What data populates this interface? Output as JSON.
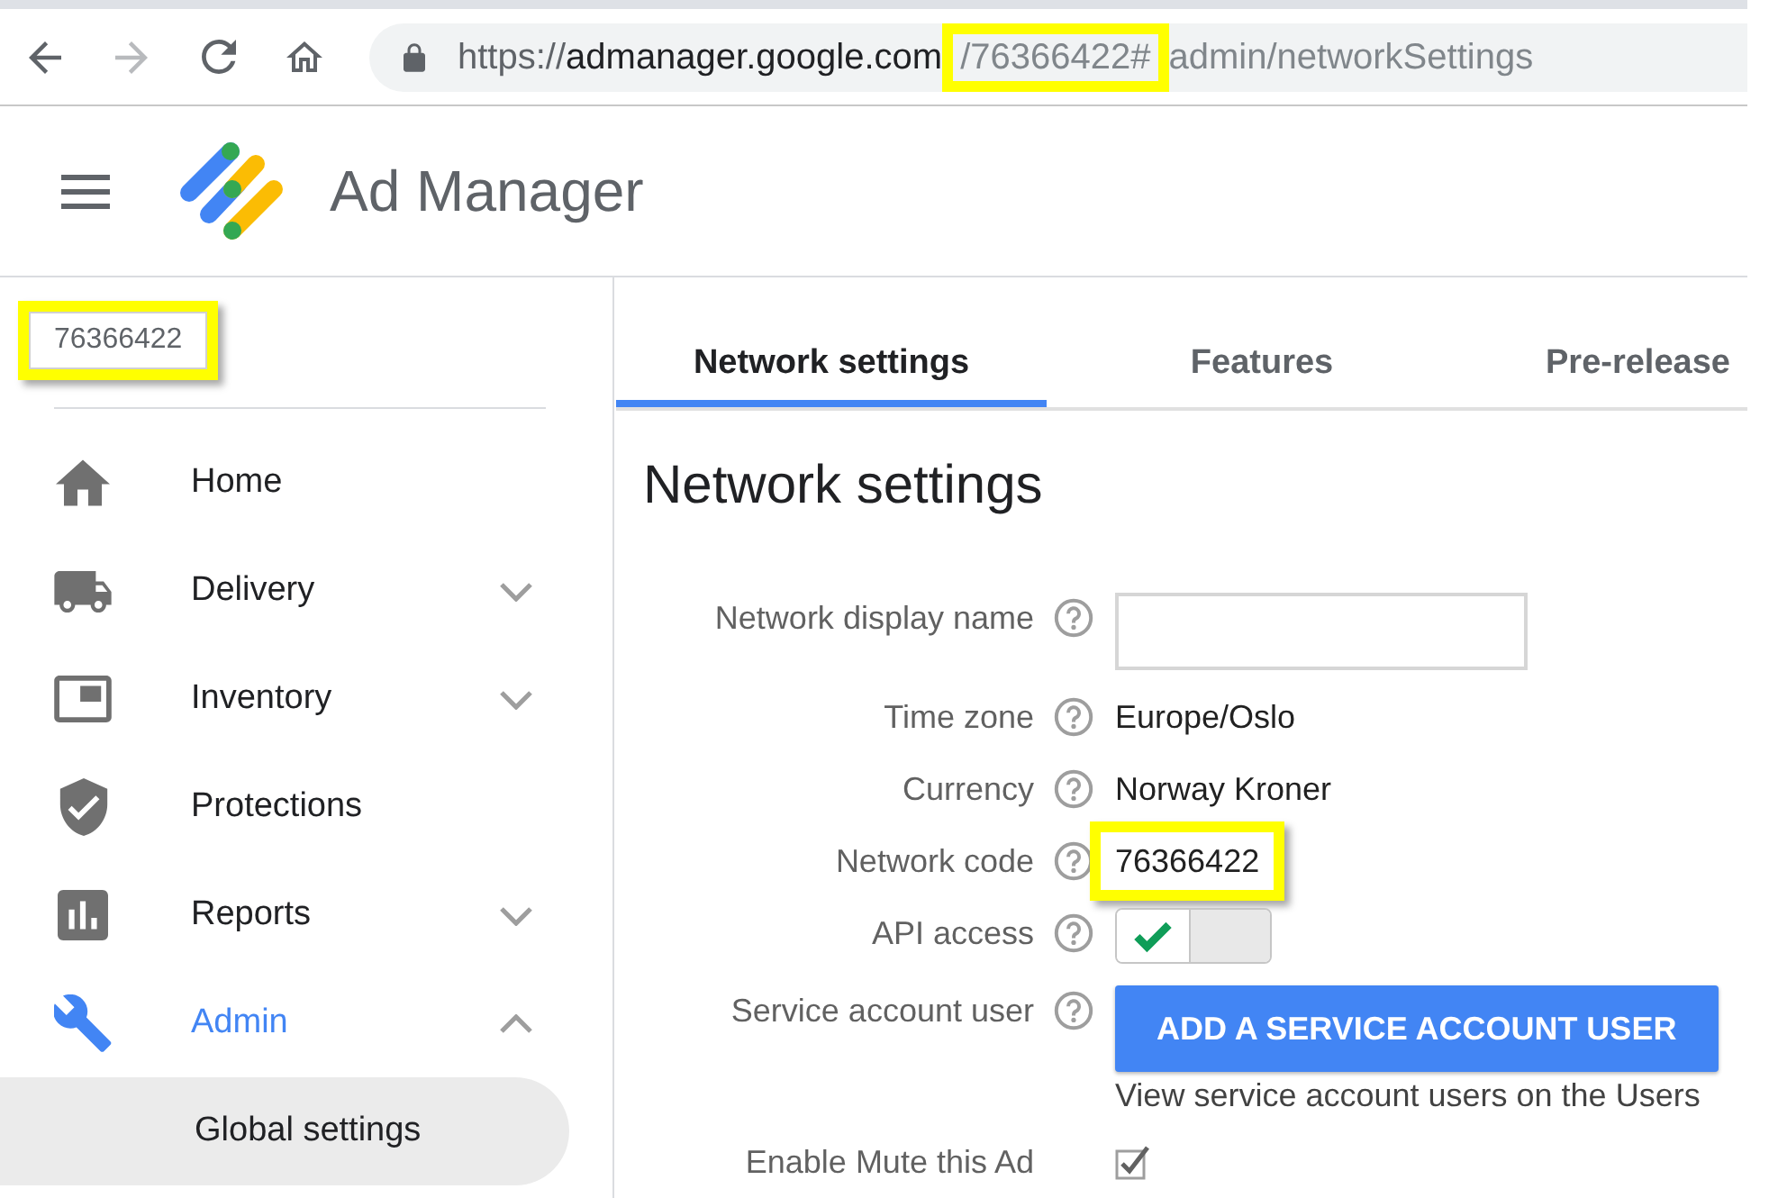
{
  "browser": {
    "nav_buttons": [
      {
        "kind": "back",
        "disabled": false
      },
      {
        "kind": "forward",
        "disabled": true
      },
      {
        "kind": "reload",
        "disabled": false
      },
      {
        "kind": "home",
        "disabled": false
      }
    ],
    "url": [
      {
        "kind": "scheme",
        "text": "https://",
        "highlighted": false
      },
      {
        "kind": "host",
        "text": "admanager.google.com",
        "highlighted": false
      },
      {
        "kind": "path",
        "text": "/76366422#",
        "highlighted": true
      },
      {
        "kind": "path",
        "text": "admin/networkSettings",
        "highlighted": false
      }
    ]
  },
  "header": {
    "title": "Ad Manager"
  },
  "sidebar": {
    "network_code": {
      "text": "76366422",
      "highlighted": true
    },
    "items": [
      {
        "label": "Home",
        "selected": false,
        "expandable": false
      },
      {
        "label": "Delivery",
        "selected": false,
        "expandable": true,
        "expanded": false
      },
      {
        "label": "Inventory",
        "selected": false,
        "expandable": true,
        "expanded": false
      },
      {
        "label": "Protections",
        "selected": false,
        "expandable": false
      },
      {
        "label": "Reports",
        "selected": false,
        "expandable": true,
        "expanded": false
      },
      {
        "label": "Admin",
        "selected": true,
        "expandable": true,
        "expanded": true,
        "children": [
          {
            "label": "Global settings",
            "selected": true
          }
        ]
      }
    ]
  },
  "main": {
    "tabs": [
      {
        "label": "Network settings",
        "selected": true
      },
      {
        "label": "Features",
        "selected": false
      },
      {
        "label": "Pre-release",
        "selected": false
      }
    ],
    "heading": "Network settings",
    "fields": [
      {
        "kind": "input",
        "label": "Network display name",
        "help": true,
        "highlighted": false
      },
      {
        "kind": "text",
        "label": "Time zone",
        "value": "Europe/Oslo",
        "help": true,
        "highlighted": false
      },
      {
        "kind": "text",
        "label": "Currency",
        "value": "Norway Kroner",
        "help": true,
        "highlighted": false
      },
      {
        "kind": "text",
        "label": "Network code",
        "value": "76366422",
        "help": true,
        "highlighted": true
      },
      {
        "kind": "toggle",
        "label": "API access",
        "on": true,
        "help": true,
        "highlighted": false
      },
      {
        "kind": "button",
        "label": "Service account user",
        "button": "ADD A SERVICE ACCOUNT USER",
        "note": "View service account users on the Users",
        "help": true,
        "highlighted": false
      },
      {
        "kind": "checkbox",
        "label": "Enable Mute this Ad",
        "checked": true,
        "help": false,
        "highlighted": false
      }
    ]
  }
}
